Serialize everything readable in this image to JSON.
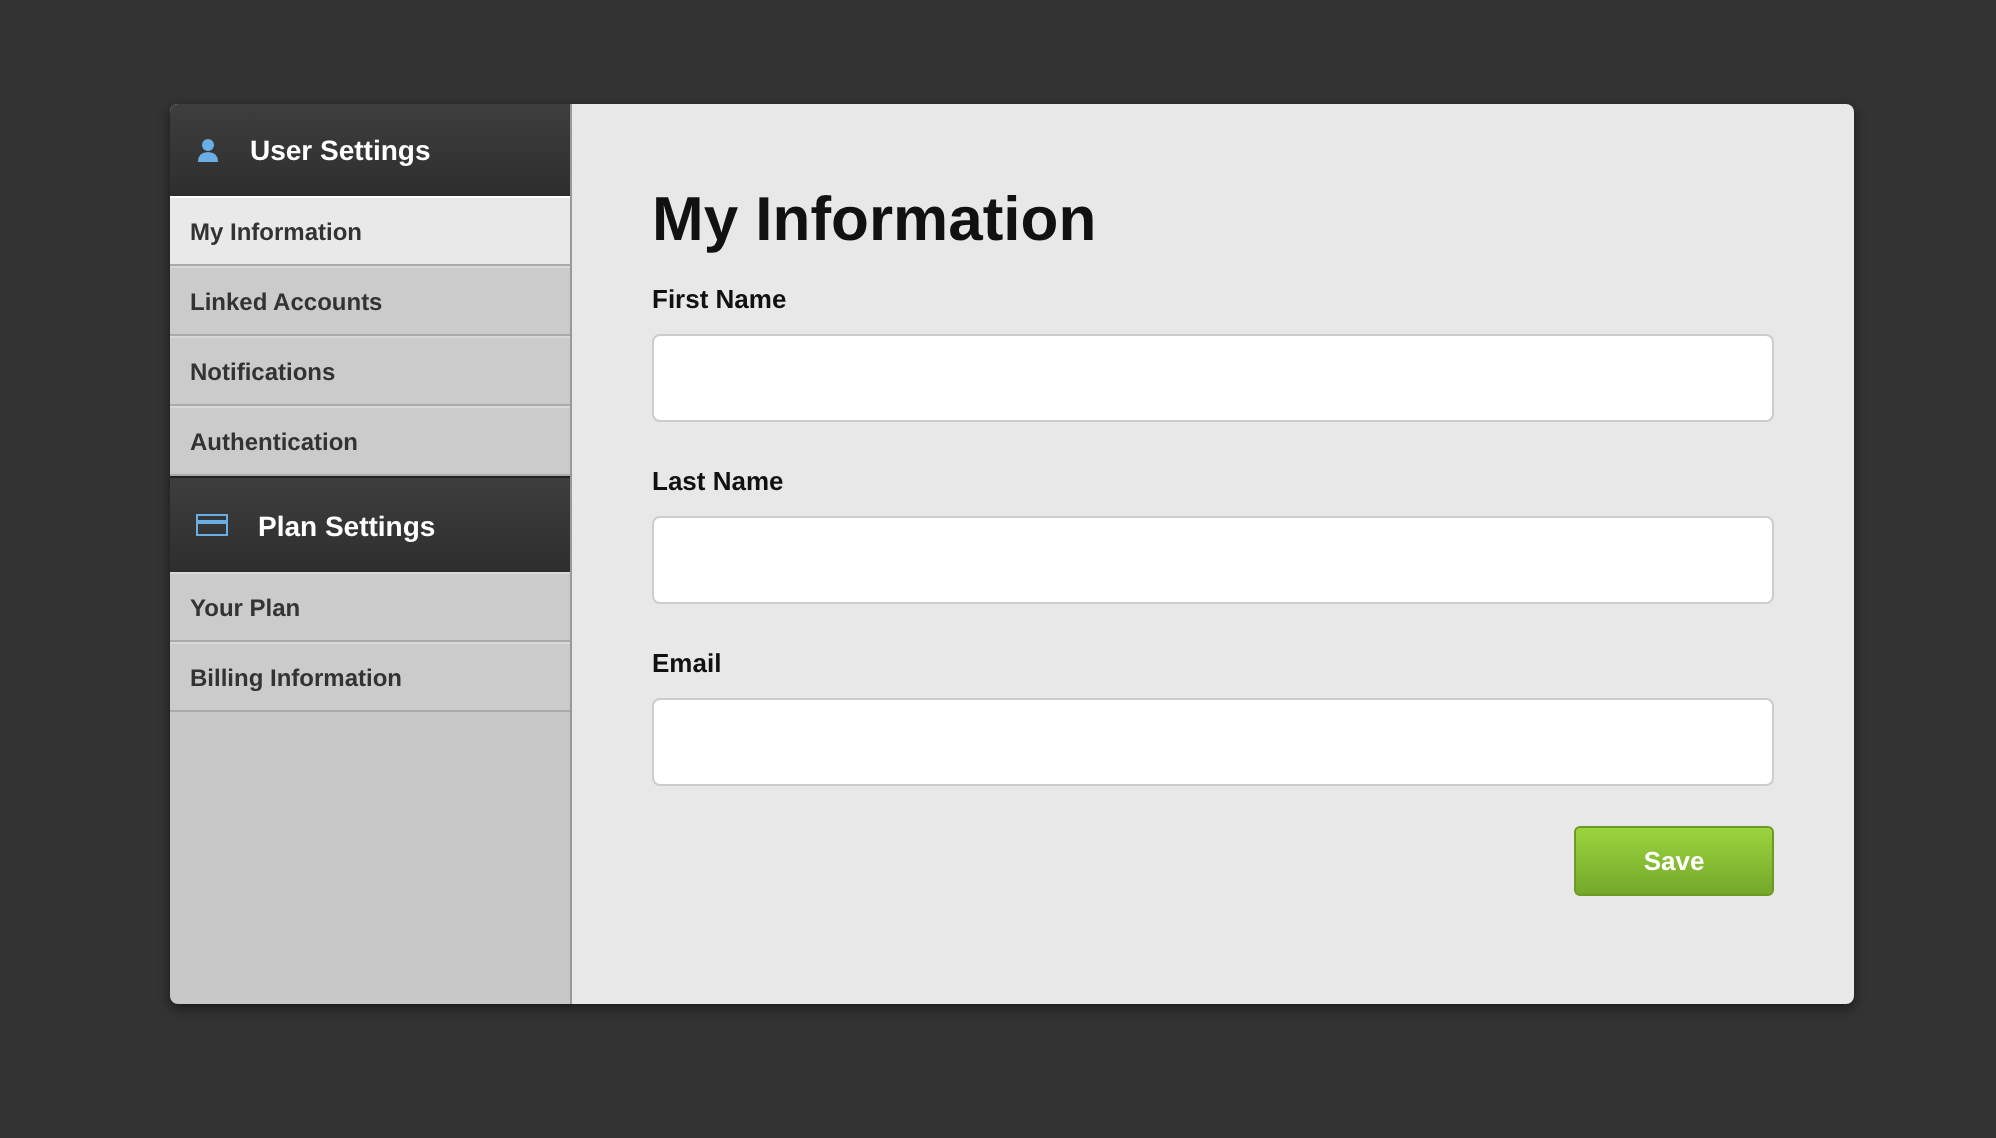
{
  "sidebar": {
    "sections": [
      {
        "title": "User Settings",
        "kind": "person",
        "items": [
          {
            "label": "My Information",
            "selected": true
          },
          {
            "label": "Linked Accounts",
            "selected": false
          },
          {
            "label": "Notifications",
            "selected": false
          },
          {
            "label": "Authentication",
            "selected": false
          }
        ]
      },
      {
        "title": "Plan Settings",
        "kind": "card",
        "items": [
          {
            "label": "Your Plan",
            "selected": false
          },
          {
            "label": "Billing Information",
            "selected": false
          }
        ]
      }
    ]
  },
  "main": {
    "title": "My Information",
    "fields": [
      {
        "label": "First Name"
      },
      {
        "label": "Last Name"
      },
      {
        "label": "Email"
      }
    ],
    "button": "Save"
  }
}
